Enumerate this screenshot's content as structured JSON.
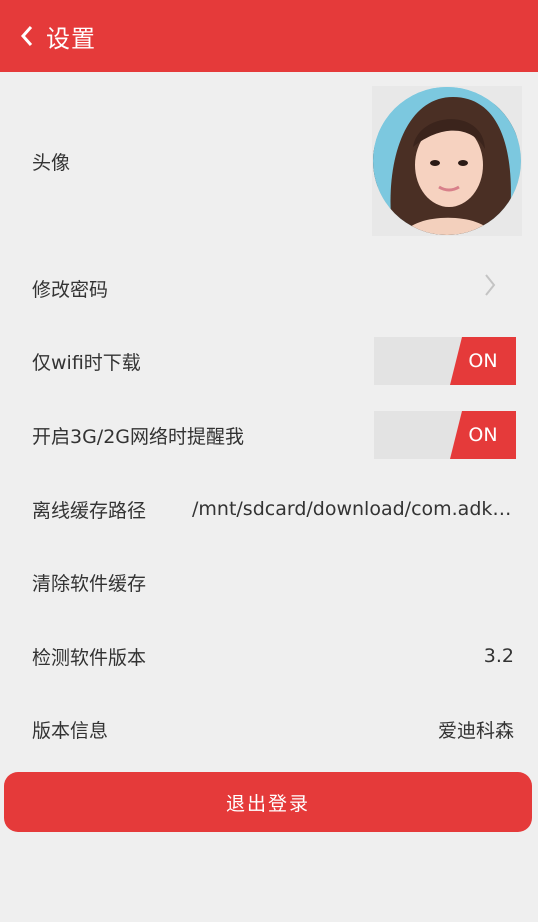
{
  "header": {
    "title": "设置",
    "back_icon": "chevron-left-icon"
  },
  "settings": {
    "avatar_label": "头像",
    "change_password_label": "修改密码",
    "wifi_only_label": "仅wifi时下载",
    "wifi_only_state": "ON",
    "notify_3g_label": "开启3G/2G网络时提醒我",
    "notify_3g_state": "ON",
    "cache_path_label": "离线缓存路径",
    "cache_path_value": "/mnt/sdcard/download/com.adks.a...",
    "clear_cache_label": "清除软件缓存",
    "check_version_label": "检测软件版本",
    "check_version_value": "3.2",
    "version_info_label": "版本信息",
    "version_info_value": "爱迪科森"
  },
  "logout_label": "退出登录",
  "colors": {
    "accent": "#e53a3a",
    "background": "#efefef",
    "toggle_off": "#e3e3e3"
  }
}
